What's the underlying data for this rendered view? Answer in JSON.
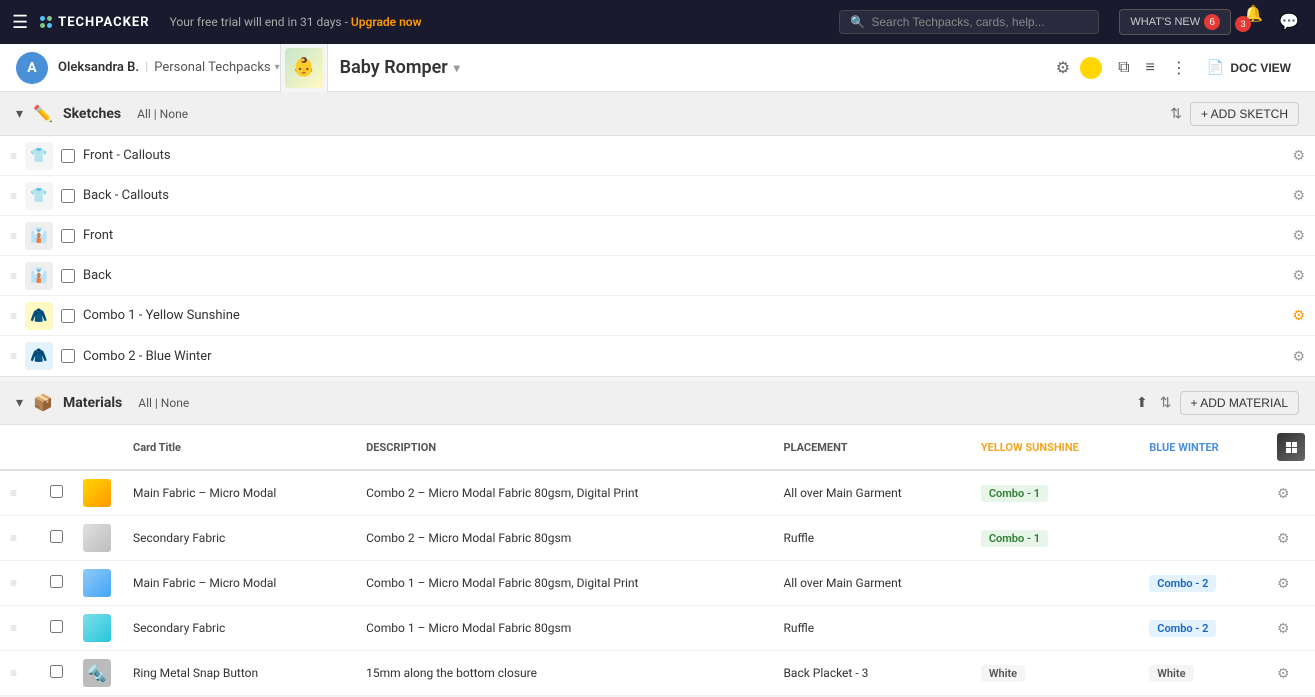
{
  "topNav": {
    "hamburger": "☰",
    "logoName": "TECHPACKER",
    "trialText": "Your free trial will end in 31 days -",
    "upgradeLink": "Upgrade now",
    "searchPlaceholder": "Search Techpacks, cards, help...",
    "whatsNew": "WHAT'S NEW",
    "whatsNewBadge": "6",
    "notifBadge": "3"
  },
  "secondNav": {
    "userInitial": "A",
    "userName": "Oleksandra B.",
    "workspace": "Personal Techpacks",
    "productName": "Baby Romper"
  },
  "sketches": {
    "title": "Sketches",
    "filterAll": "All",
    "filterNone": "None",
    "addLabel": "+ ADD SKETCH",
    "items": [
      {
        "name": "Front - Callouts",
        "emoji": "👕",
        "gearActive": false
      },
      {
        "name": "Back - Callouts",
        "emoji": "👕",
        "gearActive": false
      },
      {
        "name": "Front",
        "emoji": "👕",
        "gearActive": false
      },
      {
        "name": "Back",
        "emoji": "👕",
        "gearActive": false
      },
      {
        "name": "Combo 1 - Yellow Sunshine",
        "emoji": "🧥",
        "gearActive": true
      },
      {
        "name": "Combo 2 - Blue Winter",
        "emoji": "🧥",
        "gearActive": false
      }
    ]
  },
  "materials": {
    "title": "Materials",
    "filterAll": "All",
    "filterNone": "None",
    "addLabel": "+ ADD MATERIAL",
    "columns": {
      "cardTitle": "Card Title",
      "description": "DESCRIPTION",
      "placement": "PLACEMENT",
      "yellowCol": "YELLOW SUNSHINE",
      "blueCol": "BLUE WINTER"
    },
    "rows": [
      {
        "thumb": "yellow",
        "cardTitle": "Main Fabric – Micro Modal",
        "description": "Combo 2 – Micro Modal Fabric 80gsm, Digital Print",
        "placement": "All over Main Garment",
        "yellowVal": "Combo - 1",
        "blueVal": ""
      },
      {
        "thumb": "gray",
        "cardTitle": "Secondary Fabric",
        "description": "Combo 2 – Micro Modal Fabric 80gsm",
        "placement": "Ruffle",
        "yellowVal": "Combo - 1",
        "blueVal": ""
      },
      {
        "thumb": "blue",
        "cardTitle": "Main Fabric – Micro Modal",
        "description": "Combo 1 – Micro Modal Fabric 80gsm, Digital Print",
        "placement": "All over Main Garment",
        "yellowVal": "",
        "blueVal": "Combo - 2"
      },
      {
        "thumb": "cyan",
        "cardTitle": "Secondary Fabric",
        "description": "Combo 1 – Micro Modal Fabric 80gsm",
        "placement": "Ruffle",
        "yellowVal": "",
        "blueVal": "Combo - 2"
      },
      {
        "thumb": "metal",
        "cardTitle": "Ring Metal Snap Button",
        "description": "15mm along the bottom closure",
        "placement": "Back Placket - 3",
        "yellowVal": "White",
        "blueVal": "White"
      }
    ]
  }
}
